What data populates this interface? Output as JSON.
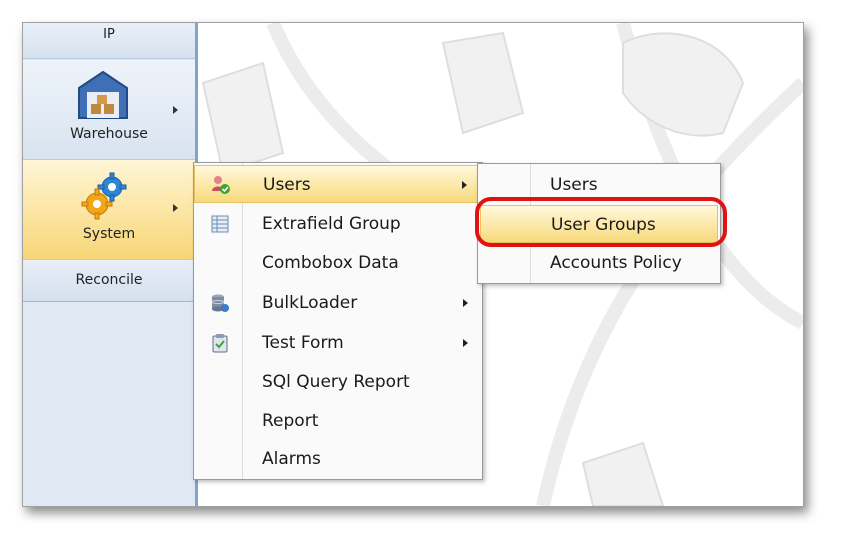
{
  "sidebar": {
    "items": [
      {
        "label": "IP"
      },
      {
        "label": "Warehouse",
        "icon": "warehouse-icon"
      },
      {
        "label": "System",
        "icon": "gears-icon"
      },
      {
        "label": "Reconcile"
      }
    ]
  },
  "menu": {
    "items": [
      {
        "label": "Users",
        "icon": "users-icon",
        "has_submenu": true,
        "highlighted": true
      },
      {
        "label": "Extrafield Group",
        "icon": "table-icon"
      },
      {
        "label": "Combobox Data"
      },
      {
        "label": "BulkLoader",
        "icon": "database-icon",
        "has_submenu": true
      },
      {
        "label": "Test Form",
        "icon": "clipboard-icon",
        "has_submenu": true
      },
      {
        "label": "SQl Query Report"
      },
      {
        "label": "Report"
      },
      {
        "label": "Alarms"
      }
    ]
  },
  "submenu": {
    "items": [
      {
        "label": "Users"
      },
      {
        "label": "User Groups",
        "highlighted": true
      },
      {
        "label": "Accounts Policy"
      }
    ]
  },
  "colors": {
    "highlight": "#fce7a6",
    "sidebar_bg": "#dfe8f3",
    "annotation_ring": "#e01313"
  }
}
